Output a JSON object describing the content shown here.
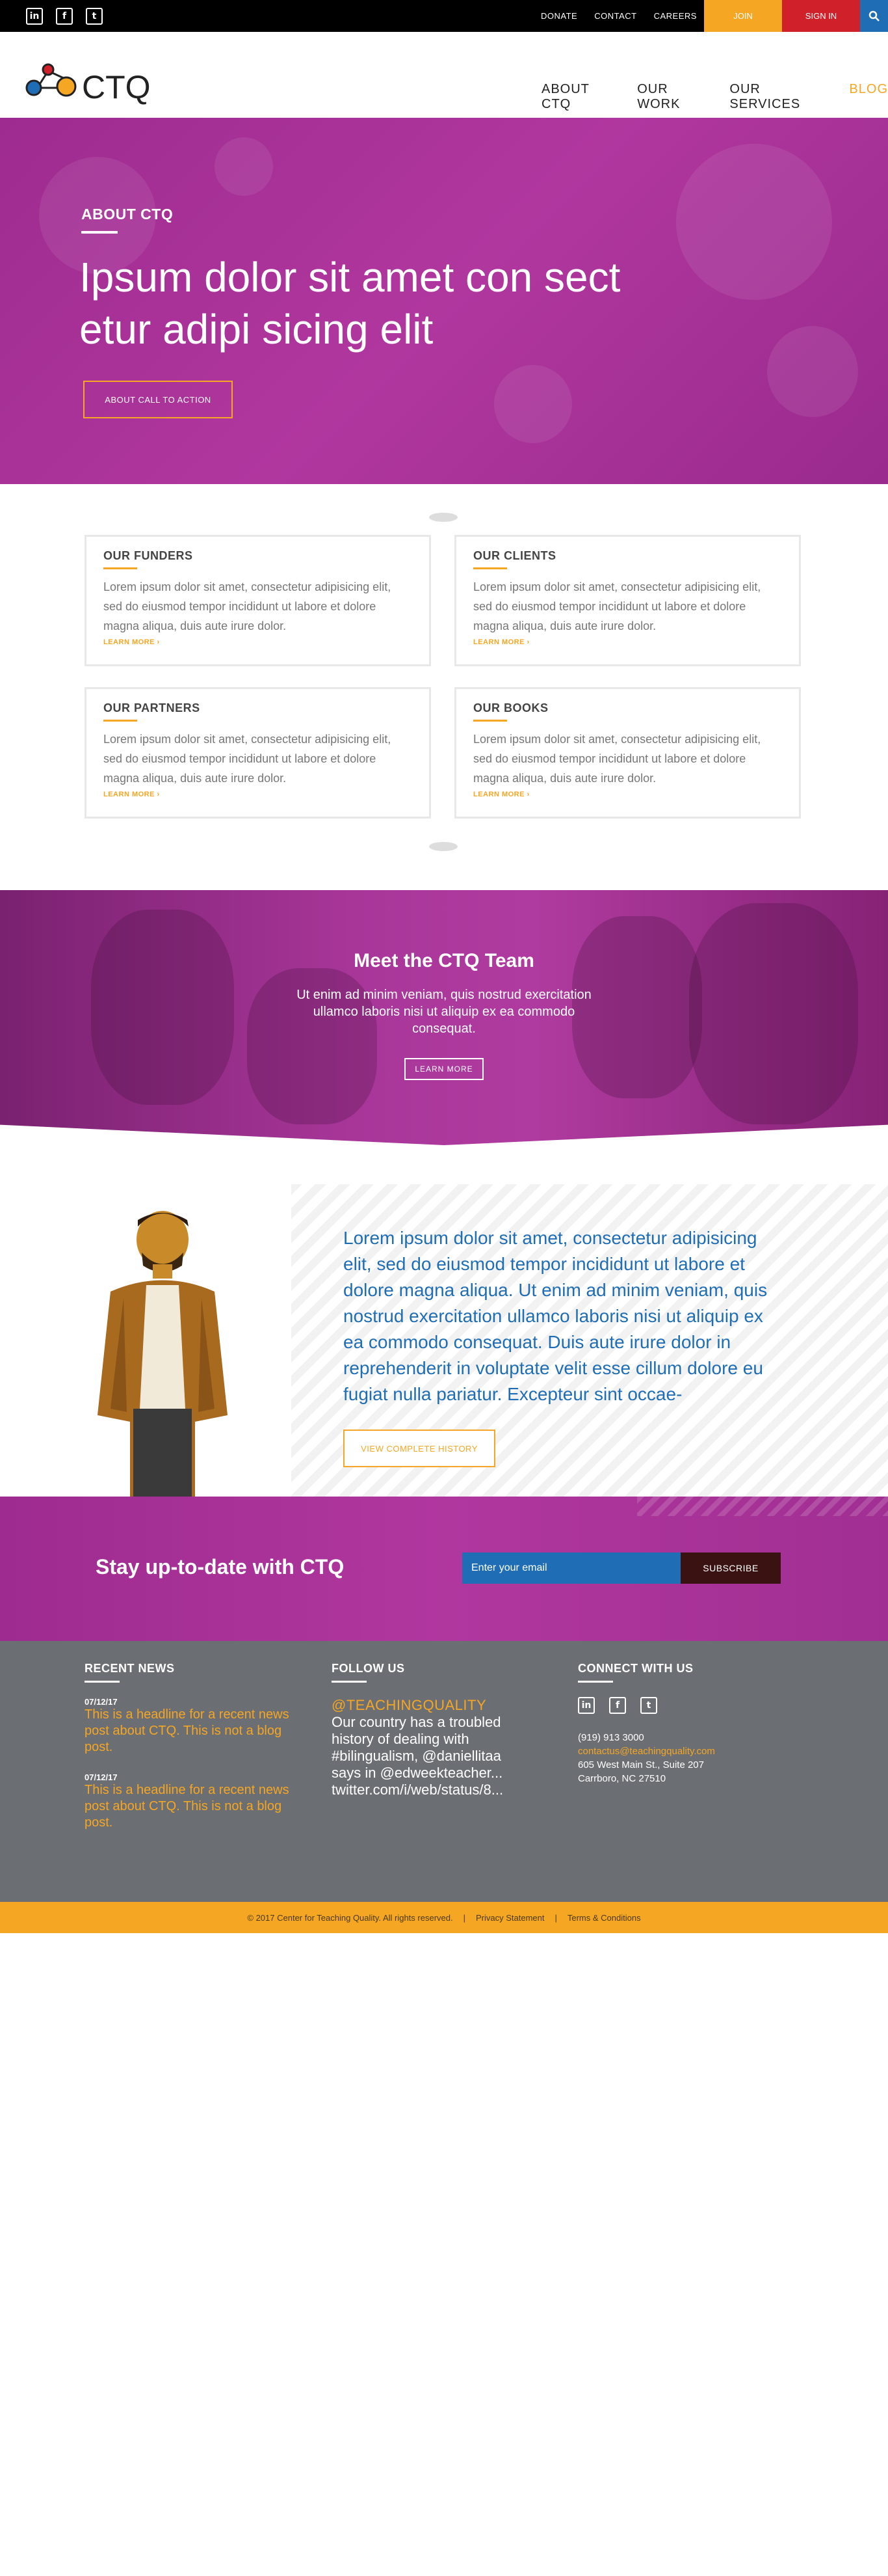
{
  "topbar": {
    "social": [
      {
        "name": "linkedin-icon",
        "glyph": "in"
      },
      {
        "name": "facebook-icon",
        "glyph": "f"
      },
      {
        "name": "twitter-icon",
        "glyph": "t"
      }
    ],
    "links": [
      "DONATE",
      "CONTACT",
      "CAREERS"
    ],
    "join": "JOIN",
    "signin": "SIGN IN"
  },
  "header": {
    "logo_text": "CTQ",
    "nav": [
      "ABOUT CTQ",
      "OUR WORK",
      "OUR SERVICES",
      "BLOG"
    ]
  },
  "hero": {
    "eyebrow": "ABOUT CTQ",
    "title": "Ipsum dolor sit amet con sect etur adipi sicing elit",
    "cta": "ABOUT CALL TO ACTION"
  },
  "cards": [
    {
      "title": "OUR FUNDERS",
      "text": "Lorem ipsum dolor sit amet, consectetur adipisicing elit, sed do eiusmod tempor incididunt ut labore et dolore magna aliqua, duis aute irure dolor.",
      "more": "LEARN MORE ›"
    },
    {
      "title": "OUR CLIENTS",
      "text": "Lorem ipsum dolor sit amet, consectetur adipisicing elit, sed do eiusmod tempor incididunt ut labore et dolore magna aliqua, duis aute irure dolor.",
      "more": "LEARN MORE ›"
    },
    {
      "title": "OUR PARTNERS",
      "text": "Lorem ipsum dolor sit amet, consectetur adipisicing elit, sed do eiusmod tempor incididunt ut labore et dolore magna aliqua, duis aute irure dolor.",
      "more": "LEARN MORE ›"
    },
    {
      "title": "OUR BOOKS",
      "text": "Lorem ipsum dolor sit amet, consectetur adipisicing elit, sed do eiusmod tempor incididunt ut labore et dolore magna aliqua, duis aute irure dolor.",
      "more": "LEARN MORE ›"
    }
  ],
  "team": {
    "title": "Meet the CTQ Team",
    "text": "Ut enim ad minim veniam, quis nostrud exercitation ullamco laboris nisi ut aliquip ex ea commodo consequat.",
    "button": "LEARN MORE"
  },
  "history": {
    "text": "Lorem ipsum dolor sit amet, consectetur adipisicing elit, sed do eiusmod tempor incididunt ut labore et dolore magna aliqua. Ut enim ad minim veniam, quis nostrud exercitation ullamco laboris nisi ut aliquip ex ea commodo consequat. Duis aute irure dolor in reprehenderit in voluptate velit esse cillum dolore eu fugiat nulla pariatur. Excepteur sint occae-",
    "button": "VIEW COMPLETE HISTORY"
  },
  "subscribe": {
    "title": "Stay up-to-date with CTQ",
    "placeholder": "Enter your email",
    "button": "SUBSCRIBE"
  },
  "footer": {
    "news_heading": "RECENT NEWS",
    "news": [
      {
        "date": "07/12/17",
        "title": "This is a headline for a recent news post about CTQ. This is not a blog post."
      },
      {
        "date": "07/12/17",
        "title": "This is a headline for a recent news post about CTQ. This is not a blog post."
      }
    ],
    "follow_heading": "FOLLOW US",
    "tweet_handle": "@TEACHINGQUALITY",
    "tweet": "Our country has a troubled history of dealing with #bilingualism, @daniellitaa says in @edweekteacher... twitter.com/i/web/status/8...",
    "connect_heading": "CONNECT WITH US",
    "phone": "(919) 913 3000",
    "email": "contactus@teachingquality.com",
    "address1": "605 West Main St., Suite 207",
    "address2": "Carrboro, NC 27510"
  },
  "copyright": {
    "text": "© 2017 Center for Teaching Quality. All rights reserved.",
    "privacy": "Privacy Statement",
    "terms": "Terms & Conditions",
    "sep": "|"
  },
  "colors": {
    "purple": "#a8339a",
    "orange": "#f5a623",
    "red": "#d0202a",
    "blue": "#1f6eb5",
    "footer_gray": "#6b6e72"
  }
}
